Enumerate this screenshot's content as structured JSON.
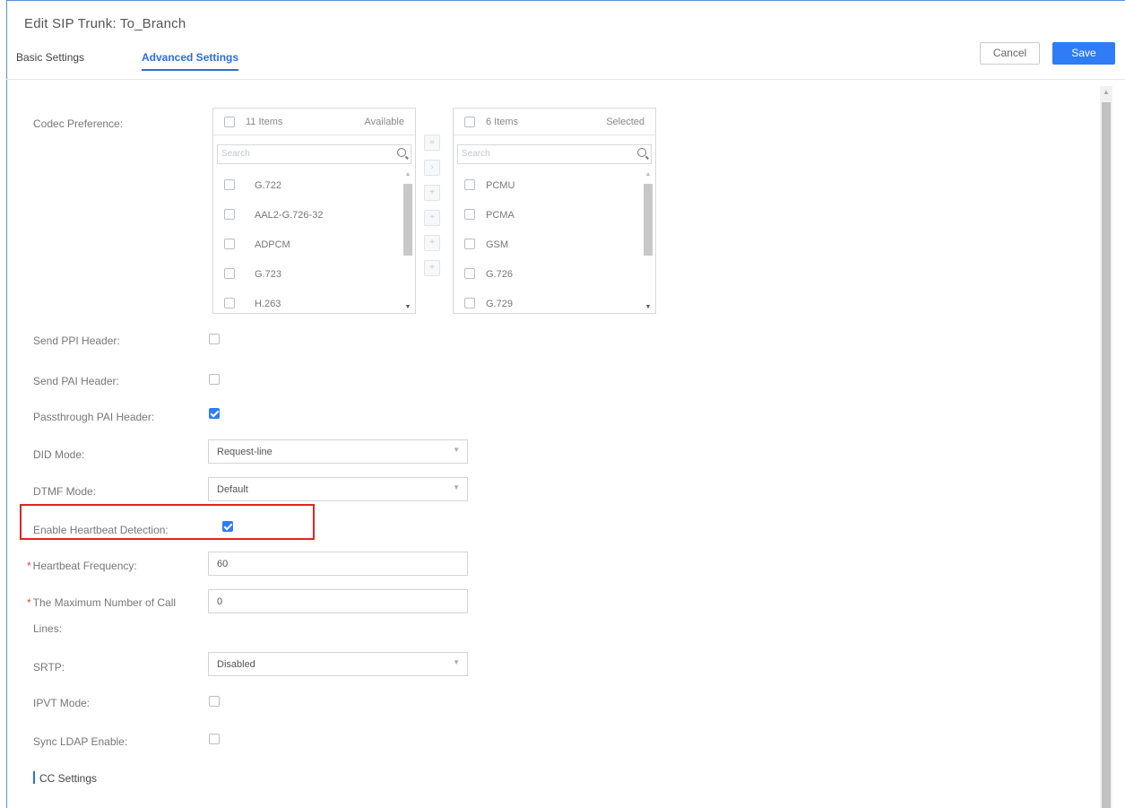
{
  "window": {
    "title": "Edit SIP Trunk: To_Branch"
  },
  "tabs": [
    {
      "label": "Basic Settings",
      "active": false
    },
    {
      "label": "Advanced Settings",
      "active": true
    }
  ],
  "actions": {
    "cancel_label": "Cancel",
    "save_label": "Save"
  },
  "colors": {
    "accent": "#2f7cf6",
    "highlight": "#e02424",
    "required": "#e0443b"
  },
  "codec_preference": {
    "label": "Codec Preference:",
    "available": {
      "count_label": "11 Items",
      "type_label": "Available",
      "search_placeholder": "Search",
      "items": [
        "G.722",
        "AAL2-G.726-32",
        "ADPCM",
        "G.723",
        "H.263"
      ]
    },
    "selected": {
      "count_label": "6 Items",
      "type_label": "Selected",
      "search_placeholder": "Search",
      "items": [
        "PCMU",
        "PCMA",
        "GSM",
        "G.726",
        "G.729"
      ]
    },
    "transfer_buttons": [
      "»",
      "›",
      "+",
      "+",
      "+",
      "+"
    ]
  },
  "fields": {
    "send_ppi_header": {
      "label": "Send PPI Header:",
      "checked": false
    },
    "send_pai_header": {
      "label": "Send PAI Header:",
      "checked": false
    },
    "passthrough_pai_header": {
      "label": "Passthrough PAI Header:",
      "checked": true
    },
    "did_mode": {
      "label": "DID Mode:",
      "value": "Request-line"
    },
    "dtmf_mode": {
      "label": "DTMF Mode:",
      "value": "Default"
    },
    "enable_heartbeat_detection": {
      "label": "Enable Heartbeat Detection:",
      "checked": true
    },
    "heartbeat_frequency": {
      "required_mark": "*",
      "label": "Heartbeat Frequency:",
      "value": "60"
    },
    "max_call_lines": {
      "required_mark": "*",
      "label_line1": "The Maximum Number of Call",
      "label_line2": "Lines:",
      "value": "0"
    },
    "srtp": {
      "label": "SRTP:",
      "value": "Disabled"
    },
    "ipvt_mode": {
      "label": "IPVT Mode:",
      "checked": false
    },
    "sync_ldap_enable": {
      "label": "Sync LDAP Enable:",
      "checked": false
    }
  },
  "sections": {
    "cc_settings": "CC Settings"
  },
  "icons": {
    "search": "search-icon",
    "caret": "chevron-down-icon",
    "check": "check-icon"
  }
}
